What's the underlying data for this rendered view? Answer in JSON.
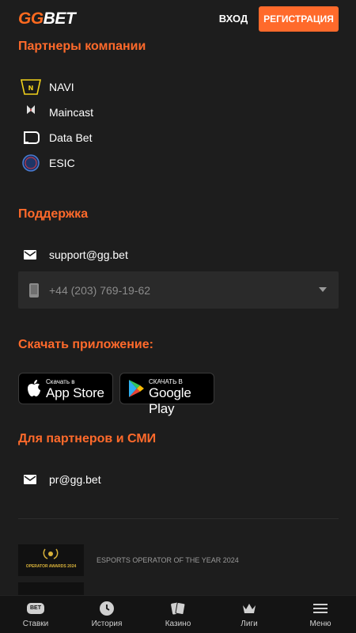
{
  "header": {
    "logo_left": "GG",
    "logo_right": "BET",
    "login_label": "ВХОД",
    "register_label": "РЕГИСТРАЦИЯ"
  },
  "partners": {
    "title": "Партнеры компании",
    "items": [
      {
        "label": "NAVI",
        "icon": "navi-logo-icon"
      },
      {
        "label": "Maincast",
        "icon": "maincast-logo-icon"
      },
      {
        "label": "Data Bet",
        "icon": "databet-logo-icon"
      },
      {
        "label": "ESIC",
        "icon": "esic-logo-icon"
      }
    ],
    "maincast_small": "MAINCAST",
    "esic_small": "ESIC"
  },
  "support": {
    "title": "Поддержка",
    "email": "support@gg.bet",
    "phone": "+44 (203) 769-19-62"
  },
  "download": {
    "title": "Скачать приложение:",
    "appstore_small": "Скачать в",
    "appstore_big": "App Store",
    "googleplay_small": "СКАЧАТЬ В",
    "googleplay_big": "Google Play"
  },
  "press": {
    "title": "Для партнеров и СМИ",
    "email": "pr@gg.bet"
  },
  "awards": {
    "badge_text": "OPERATOR AWARDS 2024",
    "text": "ESPORTS OPERATOR OF THE YEAR 2024"
  },
  "bottom_nav": {
    "items": [
      {
        "label": "Ставки",
        "icon": "bet-icon"
      },
      {
        "label": "История",
        "icon": "clock-icon"
      },
      {
        "label": "Казино",
        "icon": "cards-icon"
      },
      {
        "label": "Лиги",
        "icon": "crown-icon"
      },
      {
        "label": "Меню",
        "icon": "menu-icon"
      }
    ],
    "bet_badge": "BET"
  },
  "colors": {
    "accent": "#ff6a2b",
    "background": "#1d1d1d",
    "nav_background": "#141414"
  }
}
